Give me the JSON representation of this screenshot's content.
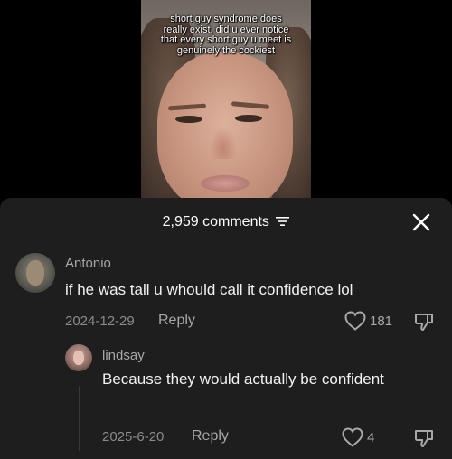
{
  "video": {
    "caption": "short guy syndrome does really exist, did u ever notice that every short guy u meet is genuinely the cockiest"
  },
  "comments_panel": {
    "count_label": "2,959 comments"
  },
  "comments": [
    {
      "username": "Antonio",
      "text": "if he was tall u whould call it confidence lol",
      "date": "2024-12-29",
      "reply_label": "Reply",
      "likes": "181"
    },
    {
      "username": "lindsay",
      "text": "Because they would actually be confident",
      "date": "2025-6-20",
      "reply_label": "Reply",
      "likes": "4"
    }
  ],
  "icons": {
    "filter": "filter-icon",
    "close": "close-icon",
    "like": "heart-icon",
    "dislike": "thumbs-down-icon"
  },
  "colors": {
    "sheet_background": "#1e1e1e",
    "page_background": "#000000",
    "muted_text": "#a8a8a8"
  }
}
